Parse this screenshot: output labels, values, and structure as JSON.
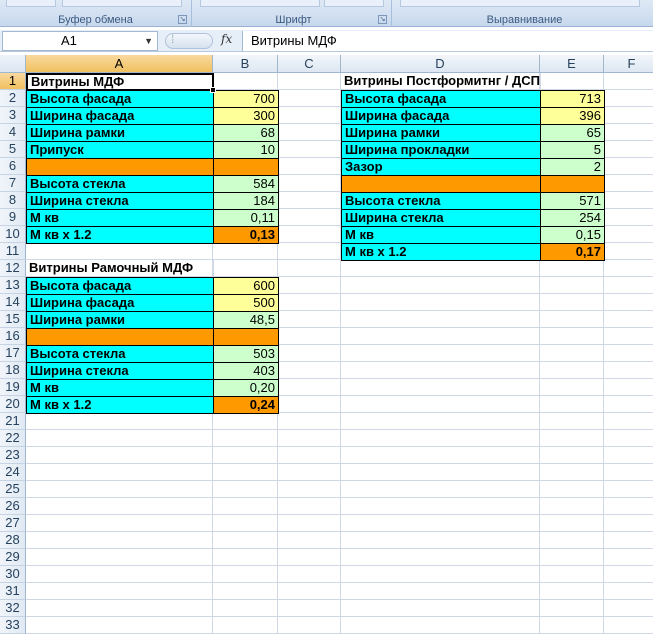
{
  "ribbon": {
    "groups": [
      {
        "label": "Буфер обмена"
      },
      {
        "label": "Шрифт"
      },
      {
        "label": "Выравнивание"
      }
    ]
  },
  "formula_bar": {
    "name_box": "A1",
    "fx": "fx",
    "content": "Витрины МДФ"
  },
  "columns": [
    "A",
    "B",
    "C",
    "D",
    "E",
    "F"
  ],
  "row_count": 33,
  "colors": {
    "cyan": "#00ffff",
    "yellow": "#ffff99",
    "green": "#ccffcc",
    "orange": "#ff9900",
    "header_selected": "#f1c15f"
  },
  "cells": [
    {
      "ref": "A1",
      "v": "Витрины МДФ",
      "bold": true,
      "active": true
    },
    {
      "ref": "A2",
      "v": "Высота фасада",
      "fill": "cyan",
      "bold": true
    },
    {
      "ref": "B2",
      "v": "700",
      "fill": "yellow",
      "num": true
    },
    {
      "ref": "A3",
      "v": "Ширина фасада",
      "fill": "cyan",
      "bold": true
    },
    {
      "ref": "B3",
      "v": "300",
      "fill": "yellow",
      "num": true
    },
    {
      "ref": "A4",
      "v": "Ширина рамки",
      "fill": "cyan",
      "bold": true
    },
    {
      "ref": "B4",
      "v": "68",
      "fill": "green",
      "num": true
    },
    {
      "ref": "A5",
      "v": "Припуск",
      "fill": "cyan",
      "bold": true
    },
    {
      "ref": "B5",
      "v": "10",
      "fill": "green",
      "num": true
    },
    {
      "ref": "A6",
      "v": "",
      "fill": "orange"
    },
    {
      "ref": "B6",
      "v": "",
      "fill": "orange"
    },
    {
      "ref": "A7",
      "v": "Высота стекла",
      "fill": "cyan",
      "bold": true
    },
    {
      "ref": "B7",
      "v": "584",
      "fill": "green",
      "num": true
    },
    {
      "ref": "A8",
      "v": "Ширина стекла",
      "fill": "cyan",
      "bold": true
    },
    {
      "ref": "B8",
      "v": "184",
      "fill": "green",
      "num": true
    },
    {
      "ref": "A9",
      "v": "М кв",
      "fill": "cyan",
      "bold": true
    },
    {
      "ref": "B9",
      "v": "0,11",
      "fill": "green",
      "num": true
    },
    {
      "ref": "A10",
      "v": "М кв х 1.2",
      "fill": "cyan",
      "bold": true
    },
    {
      "ref": "B10",
      "v": "0,13",
      "fill": "orange",
      "num": true,
      "bold": true
    },
    {
      "ref": "A12",
      "v": "Витрины Рамочный МДФ",
      "bold": true
    },
    {
      "ref": "A13",
      "v": "Высота фасада",
      "fill": "cyan",
      "bold": true
    },
    {
      "ref": "B13",
      "v": "600",
      "fill": "yellow",
      "num": true
    },
    {
      "ref": "A14",
      "v": "Ширина фасада",
      "fill": "cyan",
      "bold": true
    },
    {
      "ref": "B14",
      "v": "500",
      "fill": "yellow",
      "num": true
    },
    {
      "ref": "A15",
      "v": "Ширина рамки",
      "fill": "cyan",
      "bold": true
    },
    {
      "ref": "B15",
      "v": "48,5",
      "fill": "green",
      "num": true
    },
    {
      "ref": "A16",
      "v": "",
      "fill": "orange"
    },
    {
      "ref": "B16",
      "v": "",
      "fill": "orange"
    },
    {
      "ref": "A17",
      "v": "Высота стекла",
      "fill": "cyan",
      "bold": true
    },
    {
      "ref": "B17",
      "v": "503",
      "fill": "green",
      "num": true
    },
    {
      "ref": "A18",
      "v": "Ширина стекла",
      "fill": "cyan",
      "bold": true
    },
    {
      "ref": "B18",
      "v": "403",
      "fill": "green",
      "num": true
    },
    {
      "ref": "A19",
      "v": "М кв",
      "fill": "cyan",
      "bold": true
    },
    {
      "ref": "B19",
      "v": "0,20",
      "fill": "green",
      "num": true
    },
    {
      "ref": "A20",
      "v": "М кв х 1.2",
      "fill": "cyan",
      "bold": true
    },
    {
      "ref": "B20",
      "v": "0,24",
      "fill": "orange",
      "num": true,
      "bold": true
    },
    {
      "ref": "D1",
      "v": "Витрины Постформитнг / ДСП",
      "bold": true
    },
    {
      "ref": "D2",
      "v": "Высота фасада",
      "fill": "cyan",
      "bold": true
    },
    {
      "ref": "E2",
      "v": "713",
      "fill": "yellow",
      "num": true
    },
    {
      "ref": "D3",
      "v": "Ширина фасада",
      "fill": "cyan",
      "bold": true
    },
    {
      "ref": "E3",
      "v": "396",
      "fill": "yellow",
      "num": true
    },
    {
      "ref": "D4",
      "v": "Ширина рамки",
      "fill": "cyan",
      "bold": true
    },
    {
      "ref": "E4",
      "v": "65",
      "fill": "green",
      "num": true
    },
    {
      "ref": "D5",
      "v": "Ширина прокладки",
      "fill": "cyan",
      "bold": true
    },
    {
      "ref": "E5",
      "v": "5",
      "fill": "green",
      "num": true
    },
    {
      "ref": "D6",
      "v": "Зазор",
      "fill": "cyan",
      "bold": true
    },
    {
      "ref": "E6",
      "v": "2",
      "fill": "green",
      "num": true
    },
    {
      "ref": "D7",
      "v": "",
      "fill": "orange"
    },
    {
      "ref": "E7",
      "v": "",
      "fill": "orange"
    },
    {
      "ref": "D8",
      "v": "Высота стекла",
      "fill": "cyan",
      "bold": true
    },
    {
      "ref": "E8",
      "v": "571",
      "fill": "green",
      "num": true
    },
    {
      "ref": "D9",
      "v": "Ширина стекла",
      "fill": "cyan",
      "bold": true
    },
    {
      "ref": "E9",
      "v": "254",
      "fill": "green",
      "num": true
    },
    {
      "ref": "D10",
      "v": "М кв",
      "fill": "cyan",
      "bold": true
    },
    {
      "ref": "E10",
      "v": "0,15",
      "fill": "green",
      "num": true
    },
    {
      "ref": "D11",
      "v": "М кв х 1.2",
      "fill": "cyan",
      "bold": true
    },
    {
      "ref": "E11",
      "v": "0,17",
      "fill": "orange",
      "num": true,
      "bold": true
    }
  ]
}
